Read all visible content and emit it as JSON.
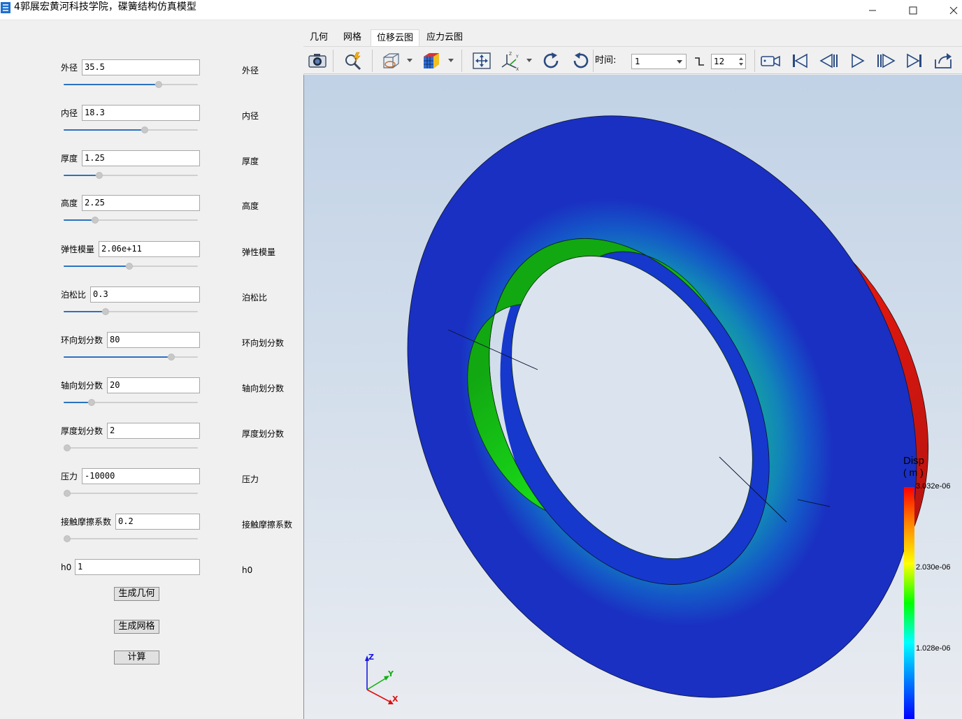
{
  "window": {
    "title": "4郭展宏黄河科技学院，碟簧结构仿真模型",
    "minimize_glyph": "—",
    "maximize_glyph": "☐",
    "close_glyph": "✕"
  },
  "params": [
    {
      "label": "外径",
      "value": "35.5",
      "slider_fraction": 0.72,
      "right_label": "外径"
    },
    {
      "label": "内径",
      "value": "18.3",
      "slider_fraction": 0.61,
      "right_label": "内径"
    },
    {
      "label": "厚度",
      "value": "1.25",
      "slider_fraction": 0.25,
      "right_label": "厚度"
    },
    {
      "label": "高度",
      "value": "2.25",
      "slider_fraction": 0.22,
      "right_label": "高度"
    },
    {
      "label": "弹性模量",
      "value": "2.06e+11",
      "slider_fraction": 0.49,
      "right_label": "弹性模量"
    },
    {
      "label": "泊松比",
      "value": "0.3",
      "slider_fraction": 0.3,
      "right_label": "泊松比"
    },
    {
      "label": "环向划分数",
      "value": "80",
      "slider_fraction": 0.82,
      "right_label": "环向划分数"
    },
    {
      "label": "轴向划分数",
      "value": "20",
      "slider_fraction": 0.19,
      "right_label": "轴向划分数"
    },
    {
      "label": "厚度划分数",
      "value": "2",
      "slider_fraction": 0.0,
      "right_label": "厚度划分数"
    },
    {
      "label": "压力",
      "value": "-10000",
      "slider_fraction": 0.0,
      "right_label": "压力"
    },
    {
      "label": "接触摩擦系数",
      "value": "0.2",
      "slider_fraction": 0.0,
      "right_label": "接触摩擦系数"
    },
    {
      "label": "h0",
      "value": "1",
      "right_label": "h0"
    }
  ],
  "buttons": {
    "generate_geometry": "生成几何",
    "generate_mesh": "生成网格",
    "compute": "计算"
  },
  "tabs": [
    {
      "label": "几何",
      "active": false
    },
    {
      "label": "网格",
      "active": false
    },
    {
      "label": "位移云图",
      "active": true
    },
    {
      "label": "应力云图",
      "active": false
    }
  ],
  "toolbar": {
    "icons": [
      "camera-icon",
      "zoom-icon",
      "view-mode-icon",
      "color-cube-icon",
      "fit-view-icon",
      "axes-orientation-icon",
      "rotate-cw-icon",
      "rotate-ccw-icon",
      "video-camera-icon",
      "first-frame-icon",
      "prev-frame-icon",
      "play-icon",
      "next-frame-icon",
      "last-frame-icon",
      "export-icon"
    ],
    "time_label": "时间:",
    "time_value": "1",
    "frame_count": "12"
  },
  "legend": {
    "title": "Disp",
    "unit": "( m )",
    "max": "3.032e-06",
    "mid": "2.030e-06",
    "low": "1.028e-06",
    "colors": [
      "#ff0000",
      "#ffff00",
      "#00ff00",
      "#00ffff",
      "#0000ff"
    ]
  },
  "axes": {
    "z_label": "Z",
    "y_label": "Y",
    "x_label": "X"
  },
  "colors": {
    "accent": "#2a72c0",
    "app_icon": "#1e6fd0"
  }
}
